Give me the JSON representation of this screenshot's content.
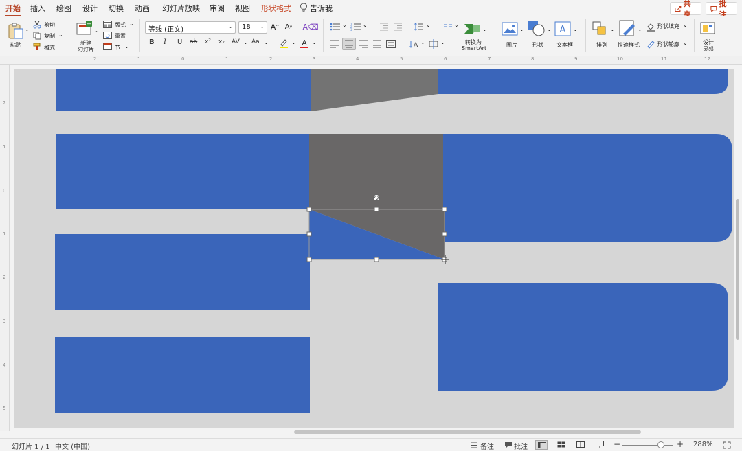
{
  "tabs": [
    {
      "label": "开始",
      "active": true
    },
    {
      "label": "插入"
    },
    {
      "label": "绘图"
    },
    {
      "label": "设计"
    },
    {
      "label": "切换"
    },
    {
      "label": "动画"
    },
    {
      "label": "幻灯片放映"
    },
    {
      "label": "审阅"
    },
    {
      "label": "视图"
    },
    {
      "label": "形状格式",
      "contextual": true
    },
    {
      "label": "告诉我"
    }
  ],
  "header_buttons": {
    "share": "共享",
    "comments": "批注"
  },
  "ribbon": {
    "paste": "粘贴",
    "cut": "剪切",
    "copy": "复制",
    "format_painter": "格式",
    "new_slide": "新建\n幻灯片",
    "new_slide_line1": "新建",
    "new_slide_line2": "幻灯片",
    "layout": "版式",
    "reset": "重置",
    "section": "节",
    "font_name": "等线 (正文)",
    "font_size": "18",
    "bold": "B",
    "italic": "I",
    "underline": "U",
    "strikethrough": "ab",
    "superscript": "x²",
    "subscript": "x₂",
    "char_spacing": "AV",
    "change_case": "Aa",
    "convert_smartart_line1": "转换为",
    "convert_smartart_line2": "SmartArt",
    "picture": "图片",
    "shapes": "形状",
    "textbox": "文本框",
    "arrange": "排列",
    "quick_styles": "快速样式",
    "shape_fill": "形状填充",
    "shape_outline": "形状轮廓",
    "design_ideas_line1": "设计",
    "design_ideas_line2": "灵感"
  },
  "ruler_h": [
    "2",
    "1",
    "0",
    "1",
    "2",
    "3",
    "4",
    "5",
    "6",
    "7",
    "8",
    "9",
    "10",
    "11",
    "12"
  ],
  "ruler_v": [
    "2",
    "1",
    "0",
    "1",
    "2",
    "3",
    "4",
    "5"
  ],
  "colors": {
    "shape_blue": "#3a65ba",
    "shape_gray_dark": "#696767",
    "shape_gray_mid": "#737373",
    "canvas_bg": "#d6d6d6",
    "accent": "#b7472a"
  },
  "statusbar": {
    "slide_info": "幻灯片 1 / 1",
    "language": "中文 (中国)",
    "notes": "备注",
    "comments": "批注",
    "zoom": "288%"
  }
}
